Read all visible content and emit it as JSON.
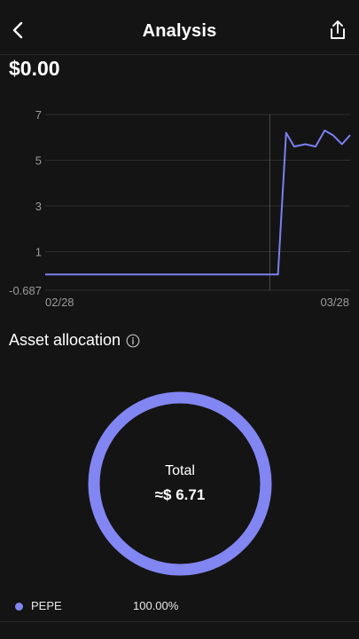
{
  "header": {
    "title": "Analysis",
    "back_icon": "chevron-left-icon",
    "share_icon": "share-icon"
  },
  "balance": "$0.00",
  "chart_data": {
    "type": "line",
    "x_tick_labels": [
      "02/28",
      "03/28"
    ],
    "y_ticks": [
      7,
      5,
      3,
      1,
      -0.687
    ],
    "y_tick_labels": [
      "7",
      "5",
      "3",
      "1",
      "-0.687"
    ],
    "ylim": [
      -0.687,
      7
    ],
    "x_range": [
      0,
      30
    ],
    "grid": true,
    "series": [
      {
        "color": "#7b7ff0",
        "points": [
          [
            0,
            0
          ],
          [
            22.9,
            0
          ],
          [
            23.7,
            6.2
          ],
          [
            24.5,
            5.6
          ],
          [
            25.6,
            5.7
          ],
          [
            26.6,
            5.6
          ],
          [
            27.5,
            6.3
          ],
          [
            28.3,
            6.1
          ],
          [
            29.2,
            5.7
          ],
          [
            30,
            6.1
          ]
        ]
      }
    ],
    "crosshair_x": 22.1
  },
  "allocation": {
    "title": "Asset allocation",
    "info_icon": "info-icon",
    "total_label": "Total",
    "total_value": "≈$ 6.71",
    "ring_color": "#8286f2",
    "legend": [
      {
        "name": "PEPE",
        "percent": "100.00%",
        "color": "#8286f2"
      }
    ]
  }
}
